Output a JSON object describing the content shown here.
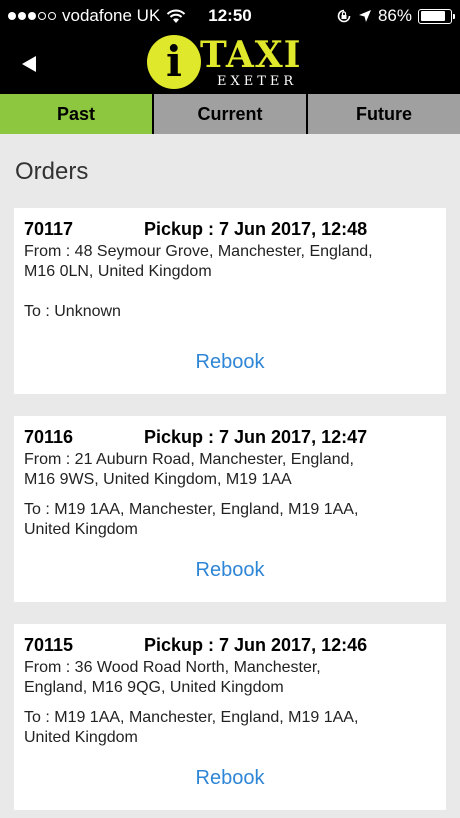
{
  "status_bar": {
    "carrier": "vodafone UK",
    "time": "12:50",
    "battery_percent": "86%",
    "battery_level": 0.86,
    "icons": [
      "signal-dots-icon",
      "wifi-icon",
      "orientation-lock-icon",
      "location-arrow-icon",
      "battery-icon"
    ]
  },
  "header": {
    "logo_letter": "i",
    "logo_title": "TAXI",
    "logo_subtitle": "EXETER",
    "logo_color": "#dfe82a",
    "back_icon": "back-arrow-icon"
  },
  "tabs": [
    {
      "label": "Past",
      "active": true
    },
    {
      "label": "Current",
      "active": false
    },
    {
      "label": "Future",
      "active": false
    }
  ],
  "colors": {
    "active_tab": "#8dc63f",
    "inactive_tab": "#a0a0a0",
    "link": "#2f86d6"
  },
  "orders_title": "Orders",
  "orders": [
    {
      "id": "70117",
      "pickup": "Pickup : 7 Jun 2017, 12:48",
      "from_line1": "From : 48 Seymour Grove, Manchester, England,",
      "from_line2": "M16 0LN, United Kingdom",
      "to_line1": "To  : Unknown",
      "to_line2": "",
      "rebook": "Rebook"
    },
    {
      "id": "70116",
      "pickup": "Pickup : 7 Jun 2017, 12:47",
      "from_line1": "From : 21 Auburn Road, Manchester, England,",
      "from_line2": "M16 9WS, United Kingdom, M19 1AA",
      "to_line1": "To  : M19 1AA, Manchester, England, M19 1AA,",
      "to_line2": "United Kingdom",
      "rebook": "Rebook"
    },
    {
      "id": "70115",
      "pickup": "Pickup : 7 Jun 2017, 12:46",
      "from_line1": "From : 36 Wood Road North, Manchester,",
      "from_line2": "England, M16 9QG, United Kingdom",
      "to_line1": "To  : M19 1AA, Manchester, England, M19 1AA,",
      "to_line2": "United Kingdom",
      "rebook": "Rebook"
    }
  ]
}
